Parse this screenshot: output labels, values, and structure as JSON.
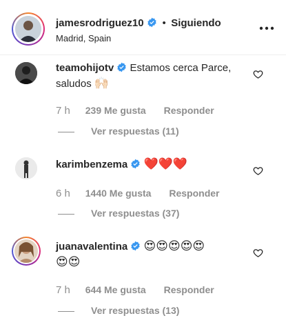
{
  "header": {
    "username": "jamesrodriguez10",
    "dot": "•",
    "follow_status": "Siguiendo",
    "location": "Madrid, Spain",
    "more_icon": "more-horizontal-icon"
  },
  "comments": [
    {
      "username": "teamohijotv",
      "text": "Estamos cerca Parce, saludos",
      "emoji": "🙌🏻",
      "time": "7 h",
      "likes": "239 Me gusta",
      "reply": "Responder",
      "replies": "Ver respuestas (11)"
    },
    {
      "username": "karimbenzema",
      "text": "",
      "emoji": "❤️❤️❤️",
      "time": "6 h",
      "likes": "1440 Me gusta",
      "reply": "Responder",
      "replies": "Ver respuestas (37)"
    },
    {
      "username": "juanavalentina",
      "text": "",
      "emoji_line1": "😍😍😍😍😍",
      "emoji_line2": "😍😍",
      "time": "7 h",
      "likes": "644 Me gusta",
      "reply": "Responder",
      "replies": "Ver respuestas (13)"
    }
  ],
  "colors": {
    "verified_blue": "#3897f0",
    "text_primary": "#262626",
    "text_secondary": "#8e8e8e"
  }
}
